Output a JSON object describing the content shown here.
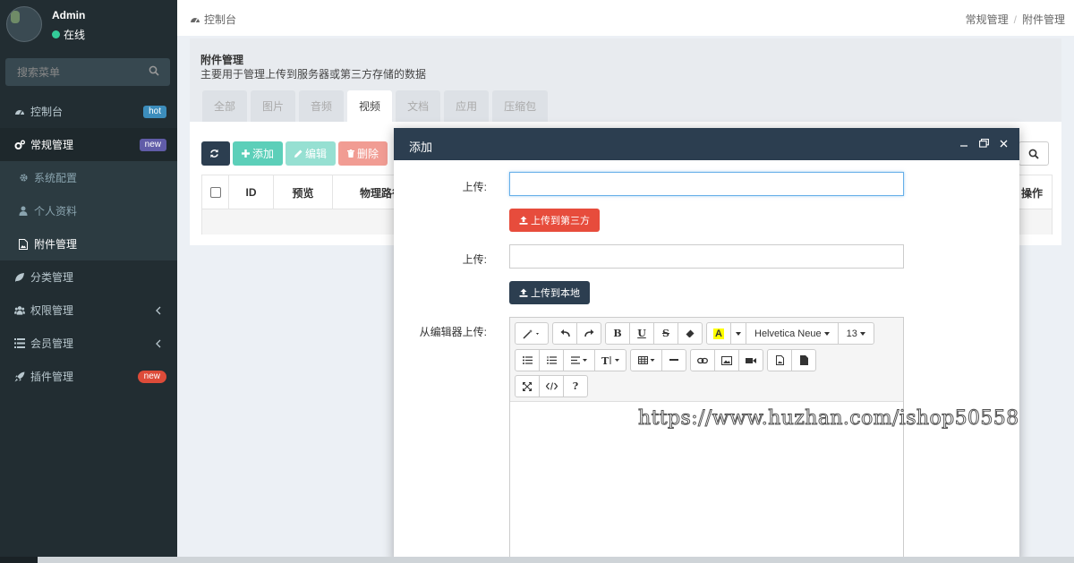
{
  "user": {
    "name": "Admin",
    "status": "在线",
    "status_color": "#33cc99"
  },
  "sidebar": {
    "search_placeholder": "搜索菜单",
    "items": [
      {
        "label": "控制台",
        "icon": "dashboard-icon",
        "badge": "hot"
      },
      {
        "label": "常规管理",
        "icon": "cogs-icon",
        "badge": "new"
      },
      {
        "label": "系统配置",
        "icon": "cog-icon"
      },
      {
        "label": "个人资料",
        "icon": "user-icon"
      },
      {
        "label": "附件管理",
        "icon": "file-image-icon"
      },
      {
        "label": "分类管理",
        "icon": "leaf-icon"
      },
      {
        "label": "权限管理",
        "icon": "group-icon"
      },
      {
        "label": "会员管理",
        "icon": "list-icon"
      },
      {
        "label": "插件管理",
        "icon": "rocket-icon",
        "badge": "new"
      }
    ]
  },
  "topbar": {
    "page_label": "控制台",
    "breadcrumb": [
      "常规管理",
      "附件管理"
    ]
  },
  "panel": {
    "title": "附件管理",
    "subtitle": "主要用于管理上传到服务器或第三方存储的数据",
    "tabs": [
      "全部",
      "图片",
      "音频",
      "视频",
      "文档",
      "应用",
      "压缩包"
    ],
    "active_tab": "视频"
  },
  "toolbar": {
    "add": "添加",
    "edit": "编辑",
    "delete": "删除"
  },
  "table": {
    "columns": [
      "ID",
      "预览",
      "物理路径",
      "操作"
    ]
  },
  "modal": {
    "title": "添加",
    "label_upload": "上传:",
    "btn_third_party": "上传到第三方",
    "btn_local": "上传到本地",
    "label_editor": "从编辑器上传:",
    "font_name": "Helvetica Neue",
    "font_size": "13"
  },
  "watermark": "https://www.huzhan.com/ishop50558",
  "colors": {
    "sidebar": "#222d32",
    "header": "#2c3e50",
    "success": "#18bc9c",
    "danger": "#e74c3c",
    "primary": "#3c8dbc"
  }
}
